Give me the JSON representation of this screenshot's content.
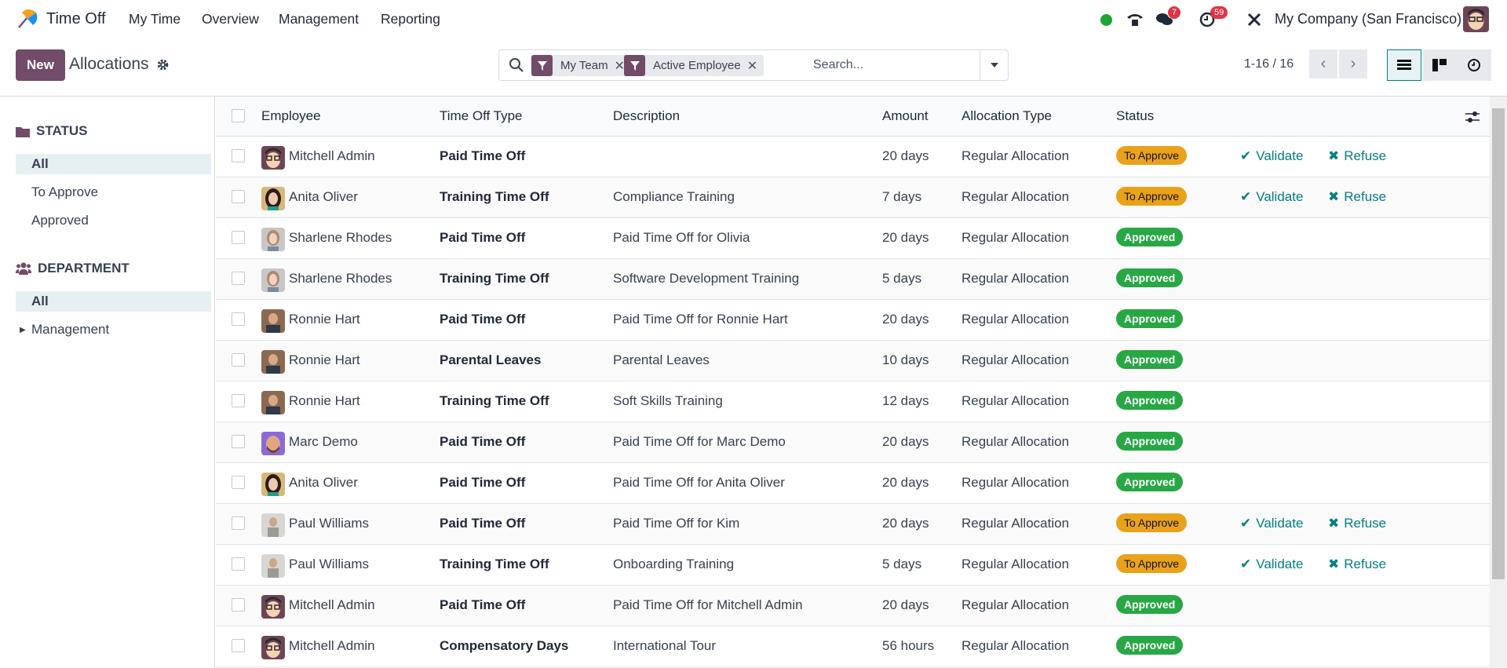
{
  "topbar": {
    "app_name": "Time Off",
    "menu": [
      "My Time",
      "Overview",
      "Management",
      "Reporting"
    ],
    "messages_count": "7",
    "activities_count": "59",
    "company": "My Company (San Francisco)"
  },
  "control": {
    "new_label": "New",
    "title": "Allocations",
    "facets": [
      {
        "label": "My Team"
      },
      {
        "label": "Active Employee"
      }
    ],
    "search_placeholder": "Search...",
    "pager": "1-16 / 16"
  },
  "sidebar": {
    "status_title": "STATUS",
    "status_items": [
      "All",
      "To Approve",
      "Approved"
    ],
    "department_title": "DEPARTMENT",
    "department_items": [
      "All",
      "Management"
    ]
  },
  "table": {
    "headers": [
      "Employee",
      "Time Off Type",
      "Description",
      "Amount",
      "Allocation Type",
      "Status"
    ],
    "actions": {
      "validate": "Validate",
      "refuse": "Refuse"
    },
    "rows": [
      {
        "employee": "Mitchell Admin",
        "type": "Paid Time Off",
        "description": "",
        "amount": "20 days",
        "allocation": "Regular Allocation",
        "status": "To Approve",
        "avatar": "cartoon"
      },
      {
        "employee": "Anita Oliver",
        "type": "Training Time Off",
        "description": "Compliance Training",
        "amount": "7 days",
        "allocation": "Regular Allocation",
        "status": "To Approve",
        "avatar": "anita"
      },
      {
        "employee": "Sharlene Rhodes",
        "type": "Paid Time Off",
        "description": "Paid Time Off for Olivia",
        "amount": "20 days",
        "allocation": "Regular Allocation",
        "status": "Approved",
        "avatar": "sharlene"
      },
      {
        "employee": "Sharlene Rhodes",
        "type": "Training Time Off",
        "description": "Software Development Training",
        "amount": "5 days",
        "allocation": "Regular Allocation",
        "status": "Approved",
        "avatar": "sharlene"
      },
      {
        "employee": "Ronnie Hart",
        "type": "Paid Time Off",
        "description": "Paid Time Off for Ronnie Hart",
        "amount": "20 days",
        "allocation": "Regular Allocation",
        "status": "Approved",
        "avatar": "ronnie"
      },
      {
        "employee": "Ronnie Hart",
        "type": "Parental Leaves",
        "description": "Parental Leaves",
        "amount": "10 days",
        "allocation": "Regular Allocation",
        "status": "Approved",
        "avatar": "ronnie"
      },
      {
        "employee": "Ronnie Hart",
        "type": "Training Time Off",
        "description": "Soft Skills Training",
        "amount": "12 days",
        "allocation": "Regular Allocation",
        "status": "Approved",
        "avatar": "ronnie"
      },
      {
        "employee": "Marc Demo",
        "type": "Paid Time Off",
        "description": "Paid Time Off for Marc Demo",
        "amount": "20 days",
        "allocation": "Regular Allocation",
        "status": "Approved",
        "avatar": "marc"
      },
      {
        "employee": "Anita Oliver",
        "type": "Paid Time Off",
        "description": "Paid Time Off for Anita Oliver",
        "amount": "20 days",
        "allocation": "Regular Allocation",
        "status": "Approved",
        "avatar": "anita"
      },
      {
        "employee": "Paul Williams",
        "type": "Paid Time Off",
        "description": "Paid Time Off for Kim",
        "amount": "20 days",
        "allocation": "Regular Allocation",
        "status": "To Approve",
        "avatar": "paul"
      },
      {
        "employee": "Paul Williams",
        "type": "Training Time Off",
        "description": "Onboarding Training",
        "amount": "5 days",
        "allocation": "Regular Allocation",
        "status": "To Approve",
        "avatar": "paul"
      },
      {
        "employee": "Mitchell Admin",
        "type": "Paid Time Off",
        "description": "Paid Time Off for Mitchell Admin",
        "amount": "20 days",
        "allocation": "Regular Allocation",
        "status": "Approved",
        "avatar": "cartoon"
      },
      {
        "employee": "Mitchell Admin",
        "type": "Compensatory Days",
        "description": "International Tour",
        "amount": "56 hours",
        "allocation": "Regular Allocation",
        "status": "Approved",
        "avatar": "cartoon"
      }
    ]
  },
  "colors": {
    "brand": "#714b67",
    "action": "#017e84",
    "to_approve": "#e9a21a",
    "approved": "#28a745"
  }
}
